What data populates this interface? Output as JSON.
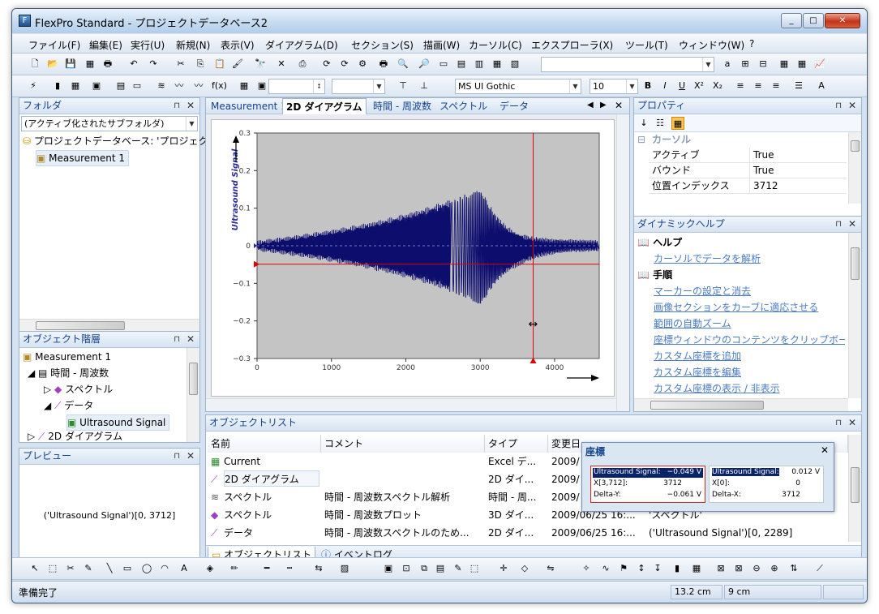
{
  "window": {
    "title": "FlexPro Standard - プロジェクトデータベース2"
  },
  "menu": [
    "ファイル(F)",
    "編集(E)",
    "実行(U)",
    "新規(N)",
    "表示(V)",
    "ダイアグラム(D)",
    "セクション(S)",
    "描画(W)",
    "カーソル(C)",
    "エクスプローラ(X)",
    "ツール(T)",
    "ウィンドウ(W)",
    "?"
  ],
  "font": {
    "name": "MS UI Gothic",
    "size": "10"
  },
  "folder_panel": {
    "title": "フォルダ",
    "combo": "(アクティブ化されたサブフォルダ)",
    "root": "プロジェクトデータベース: 'プロジェクトデータベース2'",
    "child": "Measurement 1"
  },
  "hierarchy_panel": {
    "title": "オブジェクト階層",
    "items": [
      "Measurement 1",
      "時間 - 周波数",
      "スペクトル",
      "データ",
      "Ultrasound Signal",
      "2D ダイアグラム"
    ]
  },
  "preview_panel": {
    "title": "プレビュー",
    "text": "('Ultrasound Signal')[0, 3712]"
  },
  "doc_tabs": [
    "Measurement 1",
    "2D ダイアグラム",
    "時間 - 周波数",
    "スペクトル",
    "データ"
  ],
  "chart_data": {
    "type": "line",
    "ylabel": "Ultrasound Signal",
    "xlim": [
      0,
      4600
    ],
    "ylim": [
      -0.3,
      0.3
    ],
    "xticks": [
      "0",
      "1000",
      "2000",
      "3000",
      "4000"
    ],
    "yticks": [
      "0.3",
      "0.2",
      "0.1",
      "0",
      "−0.1",
      "−0.2",
      "−0.3"
    ],
    "cursor": {
      "x": 3712,
      "y": -0.049
    },
    "colors": {
      "signal": "#0d0d6e",
      "plot_bg": "#c4c4c4",
      "cursor": "#e00000"
    }
  },
  "property_panel": {
    "title": "プロパティ",
    "section": "カーソル",
    "rows": [
      {
        "k": "アクティブ",
        "v": "True"
      },
      {
        "k": "バウンド",
        "v": "True"
      },
      {
        "k": "位置インデックス",
        "v": "3712"
      }
    ]
  },
  "help_panel": {
    "title": "ダイナミックヘルプ",
    "sec1": "ヘルプ",
    "link1": "カーソルでデータを解析",
    "sec2": "手順",
    "links": [
      "マーカーの設定と消去",
      "画像セクションをカーブに適応させる",
      "範囲の自動ズーム",
      "座標ウィンドウのコンテンツをクリップボードにコピー",
      "カスタム座標を追加",
      "カスタム座標を編集",
      "カスタム座標の表示 / 非表示"
    ]
  },
  "objlist": {
    "title": "オブジェクトリスト",
    "columns": [
      "名前",
      "コメント",
      "タイプ",
      "変更日"
    ],
    "rows": [
      {
        "name": "Current",
        "comment": "",
        "type": "Excel デ...",
        "date": "2009/",
        "extra": ""
      },
      {
        "name": "2D ダイアグラム",
        "comment": "",
        "type": "2D ダイ...",
        "date": "2009/",
        "extra": ""
      },
      {
        "name": "スペクトル",
        "comment": "時間 - 周波数スペクトル解析",
        "type": "時間 - 周...",
        "date": "2009/",
        "extra": ""
      },
      {
        "name": "スペクトル",
        "comment": "時間 - 周波数プロット",
        "type": "3D ダイ...",
        "date": "2009/06/25 16:...",
        "extra": "'スペクトル'"
      },
      {
        "name": "データ",
        "comment": "時間 - 周波数スペクトルのため...",
        "type": "2D ダイ...",
        "date": "2009/06/25 16:...",
        "extra": "('Ultrasound Signal')[0, 2289]"
      }
    ],
    "bottom_tabs": [
      "オブジェクトリスト",
      "イベントログ"
    ]
  },
  "coords": {
    "title": "座標",
    "left": [
      {
        "k": "Ultrasound Signal:",
        "v": "−0.049 V"
      },
      {
        "k": "X[3,712]:",
        "v": "3712"
      },
      {
        "k": "Delta-Y:",
        "v": "−0.061 V"
      }
    ],
    "right": [
      {
        "k": "Ultrasound Signal:",
        "v": "0.012 V"
      },
      {
        "k": "X[0]:",
        "v": "0"
      },
      {
        "k": "Delta-X:",
        "v": "3712"
      }
    ]
  },
  "status": {
    "text": "準備完了",
    "c1": "13.2 cm",
    "c2": "9 cm"
  }
}
